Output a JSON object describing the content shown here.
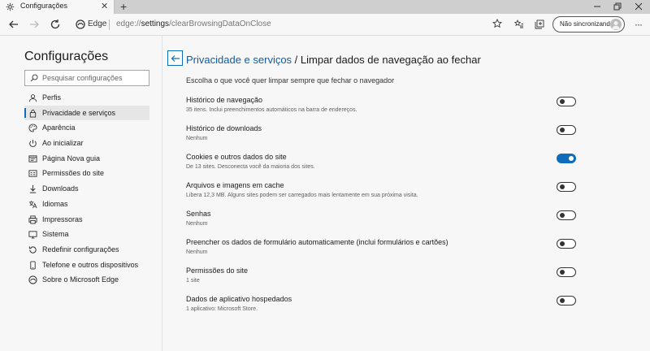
{
  "tab": {
    "title": "Configurações",
    "icon": "gear-icon",
    "close_icon": "close-icon"
  },
  "new_tab_icon": "plus-icon",
  "window_controls": [
    "minimize-icon",
    "restore-icon",
    "close-icon"
  ],
  "toolbar": {
    "site_label": "Edge",
    "url_prefix": "edge://",
    "url_host": "settings",
    "url_path": "/clearBrowsingDataOnClose",
    "profile_label": "Não sincronizando"
  },
  "sidebar": {
    "title": "Configurações",
    "search_placeholder": "Pesquisar configurações",
    "items": [
      {
        "label": "Perfis",
        "icon": "profile-icon",
        "active": false
      },
      {
        "label": "Privacidade e serviços",
        "icon": "lock-icon",
        "active": true
      },
      {
        "label": "Aparência",
        "icon": "palette-icon",
        "active": false
      },
      {
        "label": "Ao inicializar",
        "icon": "power-icon",
        "active": false
      },
      {
        "label": "Página Nova guia",
        "icon": "new-tab-page-icon",
        "active": false
      },
      {
        "label": "Permissões do site",
        "icon": "site-permissions-icon",
        "active": false
      },
      {
        "label": "Downloads",
        "icon": "download-icon",
        "active": false
      },
      {
        "label": "Idiomas",
        "icon": "language-icon",
        "active": false
      },
      {
        "label": "Impressoras",
        "icon": "printer-icon",
        "active": false
      },
      {
        "label": "Sistema",
        "icon": "system-icon",
        "active": false
      },
      {
        "label": "Redefinir configurações",
        "icon": "reset-icon",
        "active": false
      },
      {
        "label": "Telefone e outros dispositivos",
        "icon": "phone-icon",
        "active": false
      },
      {
        "label": "Sobre o Microsoft Edge",
        "icon": "edge-icon",
        "active": false
      }
    ]
  },
  "main": {
    "breadcrumb": "Privacidade e serviços",
    "separator": " / ",
    "title": "Limpar dados de navegação ao fechar",
    "intro": "Escolha o que você quer limpar sempre que fechar o navegador",
    "rows": [
      {
        "title": "Histórico de navegação",
        "subtitle": "35 itens. Inclui preenchimentos automáticos na barra de endereços.",
        "on": false
      },
      {
        "title": "Histórico de downloads",
        "subtitle": "Nenhum",
        "on": false
      },
      {
        "title": "Cookies e outros dados do site",
        "subtitle": "De 13 sites. Desconecta você da maioria dos sites.",
        "on": true
      },
      {
        "title": "Arquivos e imagens em cache",
        "subtitle": "Libera 12,3 MB. Alguns sites podem ser carregados mais lentamente em sua próxima visita.",
        "on": false
      },
      {
        "title": "Senhas",
        "subtitle": "Nenhum",
        "on": false
      },
      {
        "title": "Preencher os dados de formulário automaticamente (inclui formulários e cartões)",
        "subtitle": "Nenhum",
        "on": false
      },
      {
        "title": "Permissões do site",
        "subtitle": "1 site",
        "on": false
      },
      {
        "title": "Dados de aplicativo hospedados",
        "subtitle": "1 aplicativo: Microsoft Store.",
        "on": false
      }
    ]
  },
  "colors": {
    "accent": "#0f6cbd",
    "link": "#0f5ca8"
  }
}
